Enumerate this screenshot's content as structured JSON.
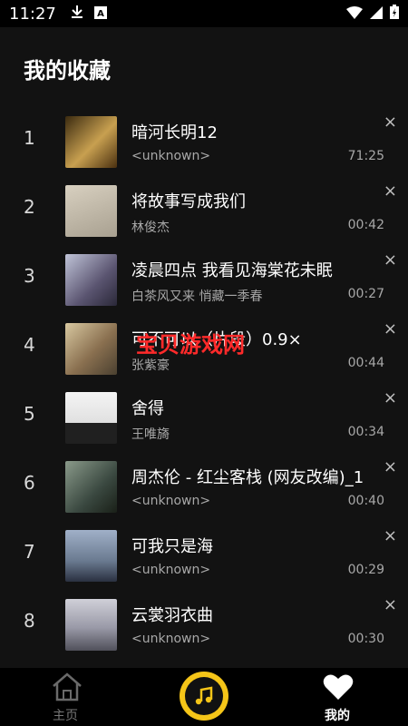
{
  "status": {
    "time": "11:27",
    "icons": [
      "download-icon",
      "a-badge-icon",
      "wifi-icon",
      "signal-icon",
      "battery-icon"
    ]
  },
  "page": {
    "title": "我的收藏"
  },
  "watermark": "宝贝游戏网",
  "songs": [
    {
      "index": "1",
      "title": "暗河长明12",
      "artist": "<unknown>",
      "duration": "71:25",
      "thumb_color": "#8b6a2a"
    },
    {
      "index": "2",
      "title": "将故事写成我们",
      "artist": "林俊杰",
      "duration": "00:42",
      "thumb_color": "#c8c0b0"
    },
    {
      "index": "3",
      "title": "凌晨四点 我看见海棠花未眠",
      "artist": "白茶风又来 悄藏一季春",
      "duration": "00:27",
      "thumb_color": "#9aa0b8"
    },
    {
      "index": "4",
      "title": "可不可以（片段）0.9×",
      "artist": "张紫豪",
      "duration": "00:44",
      "thumb_color": "#a89070"
    },
    {
      "index": "5",
      "title": "舍得",
      "artist": "王唯旖",
      "duration": "00:34",
      "thumb_color": "#e8e8e8"
    },
    {
      "index": "6",
      "title": "周杰伦 - 红尘客栈 (网友改编)_1",
      "artist": "<unknown>",
      "duration": "00:40",
      "thumb_color": "#556055"
    },
    {
      "index": "7",
      "title": "可我只是海",
      "artist": "<unknown>",
      "duration": "00:29",
      "thumb_color": "#6a7a90"
    },
    {
      "index": "8",
      "title": "云裳羽衣曲",
      "artist": "<unknown>",
      "duration": "00:30",
      "thumb_color": "#b0b0b8"
    }
  ],
  "close_symbol": "×",
  "nav": {
    "home_label": "主页",
    "mine_label": "我的"
  },
  "colors": {
    "background": "#121212",
    "accent": "#f5c518"
  }
}
